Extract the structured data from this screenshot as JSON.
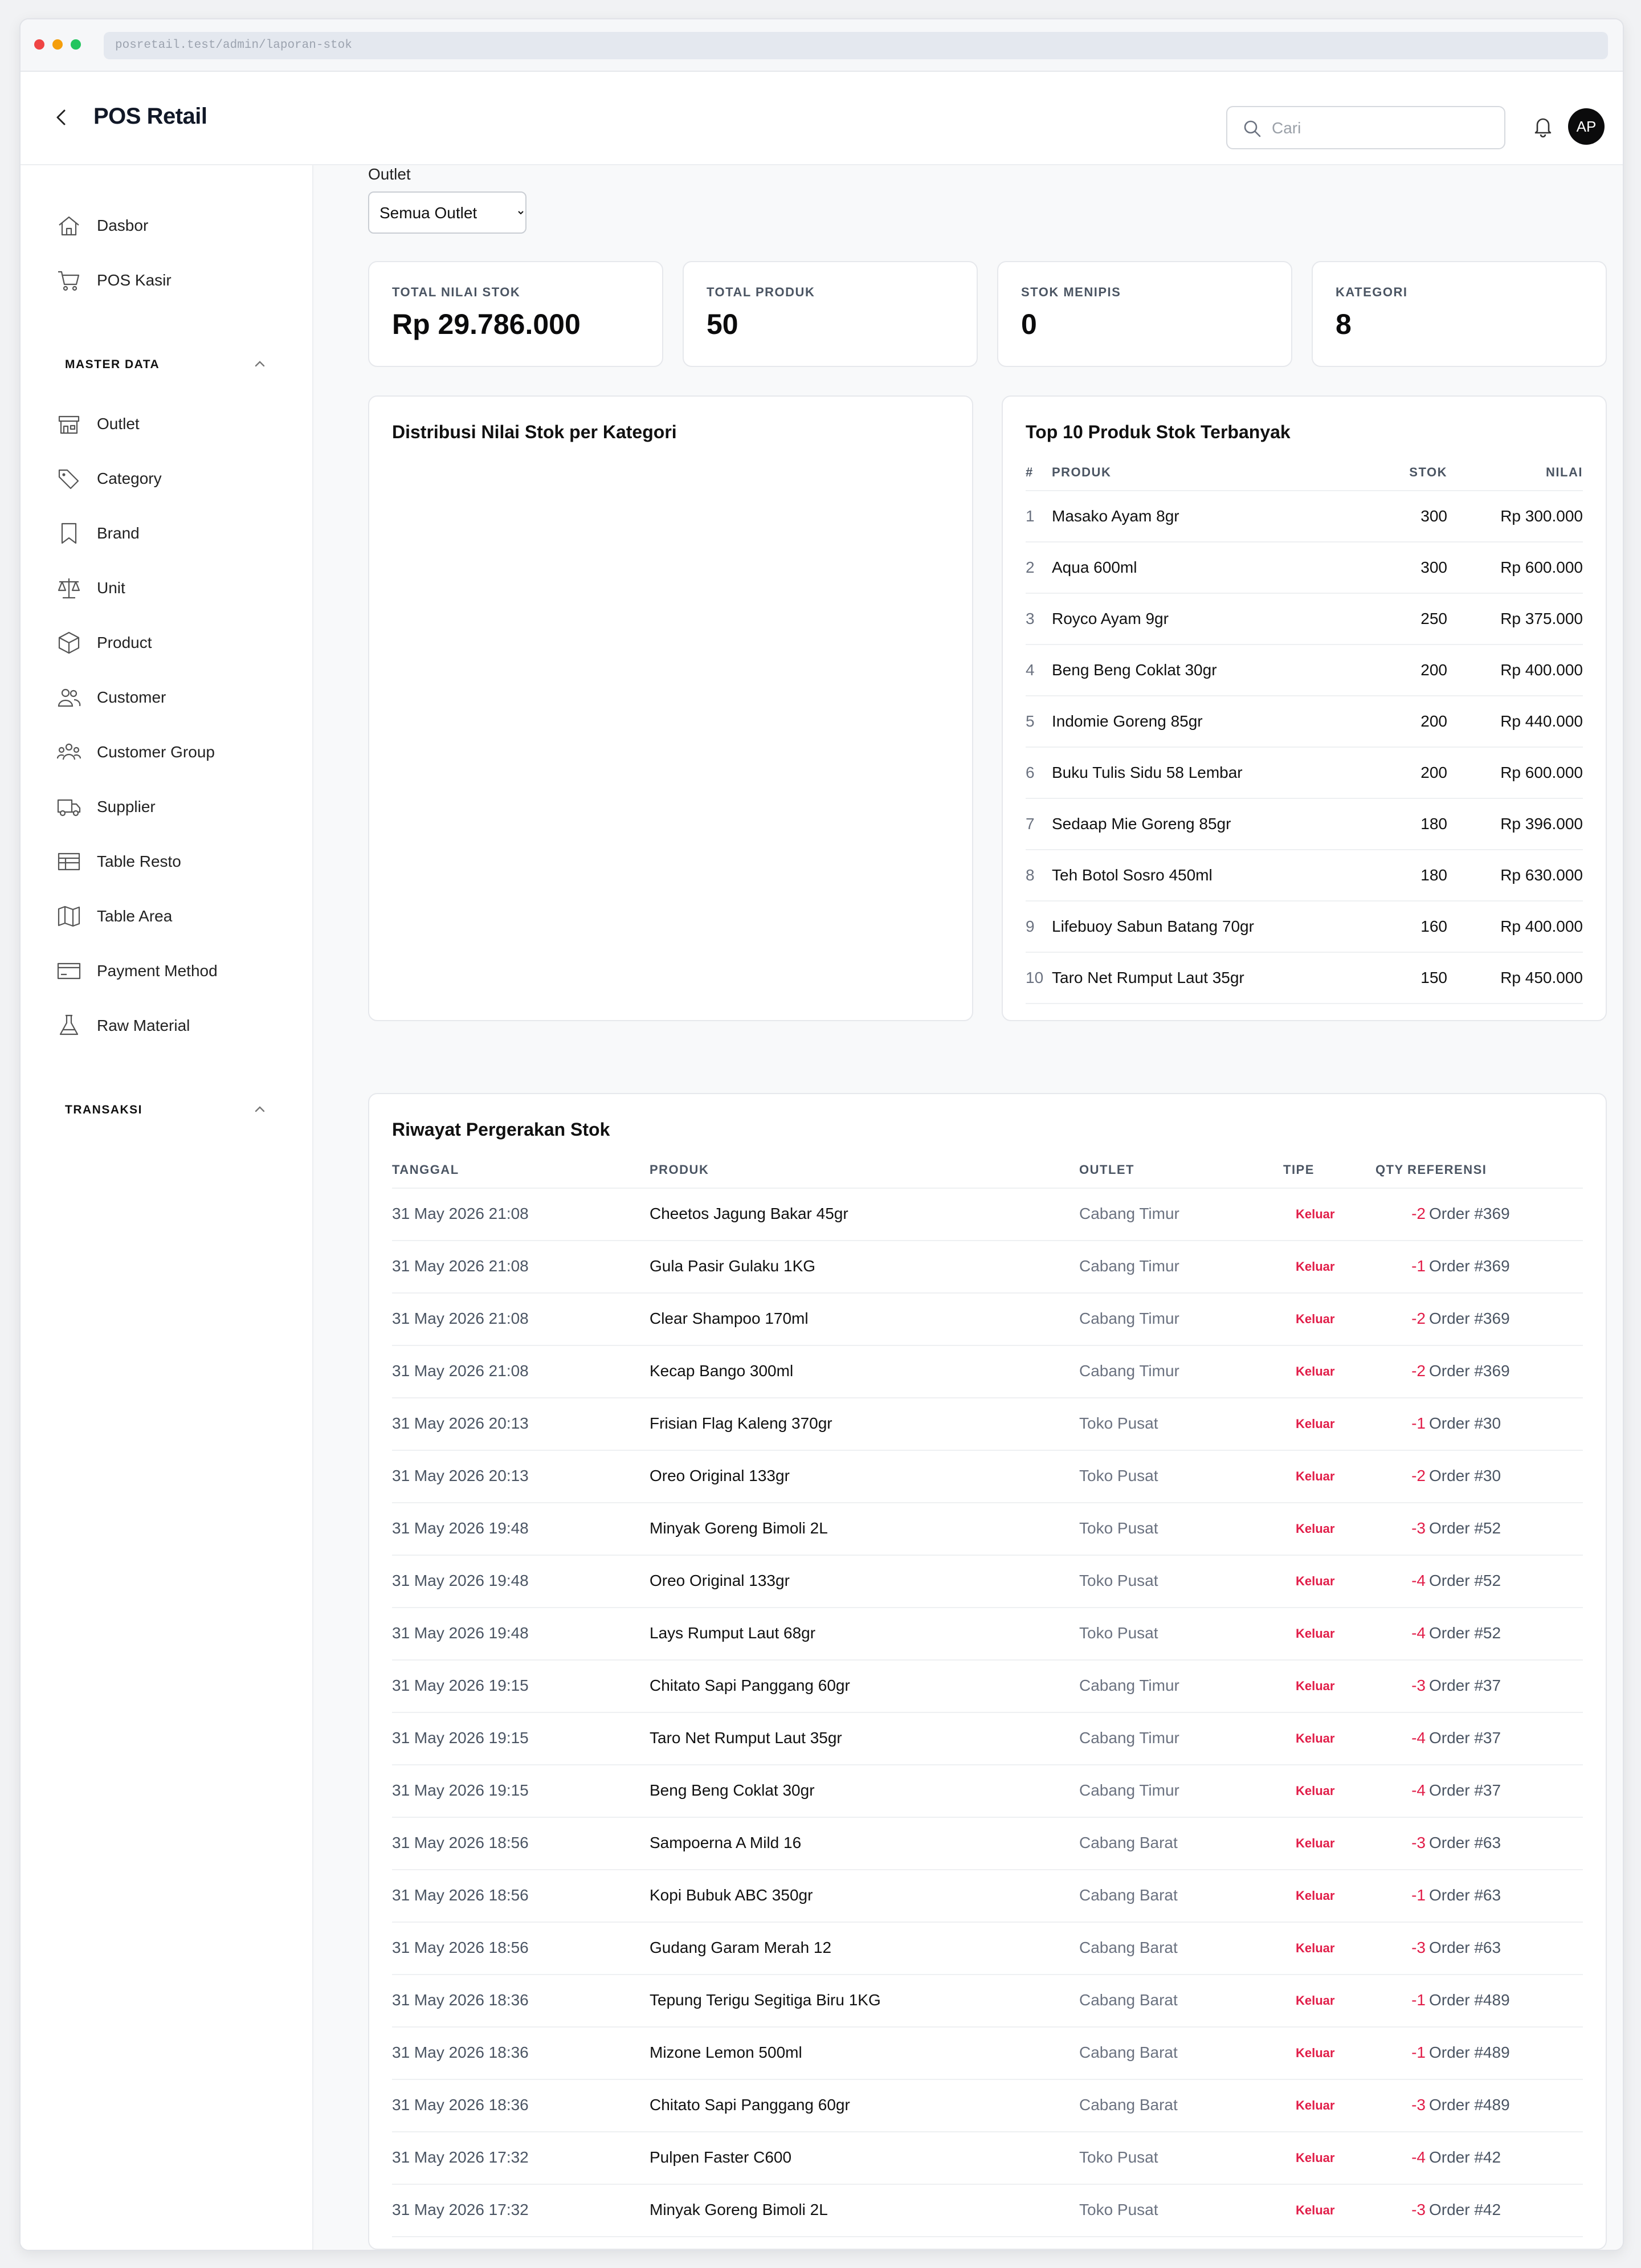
{
  "browser": {
    "url": "posretail.test/admin/laporan-stok"
  },
  "header": {
    "title": "POS Retail",
    "search_placeholder": "Cari",
    "avatar_initials": "AP"
  },
  "sidebar": {
    "top_items": [
      {
        "label": "Dasbor",
        "icon": "home-icon"
      },
      {
        "label": "POS Kasir",
        "icon": "cart-icon"
      }
    ],
    "master_data_label": "MASTER DATA",
    "master_items": [
      {
        "label": "Outlet",
        "icon": "store-icon"
      },
      {
        "label": "Category",
        "icon": "tag-icon"
      },
      {
        "label": "Brand",
        "icon": "bookmark-icon"
      },
      {
        "label": "Unit",
        "icon": "scale-icon"
      },
      {
        "label": "Product",
        "icon": "box-icon"
      },
      {
        "label": "Customer",
        "icon": "users-icon"
      },
      {
        "label": "Customer Group",
        "icon": "user-group-icon"
      },
      {
        "label": "Supplier",
        "icon": "truck-icon"
      },
      {
        "label": "Table Resto",
        "icon": "table-icon"
      },
      {
        "label": "Table Area",
        "icon": "map-icon"
      },
      {
        "label": "Payment Method",
        "icon": "credit-card-icon"
      },
      {
        "label": "Raw Material",
        "icon": "flask-icon"
      }
    ],
    "transaksi_label": "TRANSAKSI"
  },
  "filter": {
    "label": "Outlet",
    "selected": "Semua Outlet"
  },
  "stats": [
    {
      "label": "TOTAL NILAI STOK",
      "value": "Rp 29.786.000"
    },
    {
      "label": "TOTAL PRODUK",
      "value": "50"
    },
    {
      "label": "STOK MENIPIS",
      "value": "0"
    },
    {
      "label": "KATEGORI",
      "value": "8"
    }
  ],
  "distribution_card": {
    "title": "Distribusi Nilai Stok per Kategori"
  },
  "top_products": {
    "title": "Top 10 Produk Stok Terbanyak",
    "headers": {
      "num": "#",
      "product": "PRODUK",
      "stock": "STOK",
      "value": "NILAI"
    },
    "rows": [
      {
        "num": "1",
        "product": "Masako Ayam 8gr",
        "stock": "300",
        "value": "Rp 300.000"
      },
      {
        "num": "2",
        "product": "Aqua 600ml",
        "stock": "300",
        "value": "Rp 600.000"
      },
      {
        "num": "3",
        "product": "Royco Ayam 9gr",
        "stock": "250",
        "value": "Rp 375.000"
      },
      {
        "num": "4",
        "product": "Beng Beng Coklat 30gr",
        "stock": "200",
        "value": "Rp 400.000"
      },
      {
        "num": "5",
        "product": "Indomie Goreng 85gr",
        "stock": "200",
        "value": "Rp 440.000"
      },
      {
        "num": "6",
        "product": "Buku Tulis Sidu 58 Lembar",
        "stock": "200",
        "value": "Rp 600.000"
      },
      {
        "num": "7",
        "product": "Sedaap Mie Goreng 85gr",
        "stock": "180",
        "value": "Rp 396.000"
      },
      {
        "num": "8",
        "product": "Teh Botol Sosro 450ml",
        "stock": "180",
        "value": "Rp 630.000"
      },
      {
        "num": "9",
        "product": "Lifebuoy Sabun Batang 70gr",
        "stock": "160",
        "value": "Rp 400.000"
      },
      {
        "num": "10",
        "product": "Taro Net Rumput Laut 35gr",
        "stock": "150",
        "value": "Rp 450.000"
      }
    ]
  },
  "history": {
    "title": "Riwayat Pergerakan Stok",
    "headers": {
      "date": "TANGGAL",
      "product": "PRODUK",
      "outlet": "OUTLET",
      "type": "TIPE",
      "qty": "QTY",
      "ref": "REFERENSI"
    },
    "rows": [
      {
        "date": "31 May 2026 21:08",
        "product": "Cheetos Jagung Bakar 45gr",
        "outlet": "Cabang Timur",
        "type": "Keluar",
        "qty": "-2",
        "ref": "Order #369"
      },
      {
        "date": "31 May 2026 21:08",
        "product": "Gula Pasir Gulaku 1KG",
        "outlet": "Cabang Timur",
        "type": "Keluar",
        "qty": "-1",
        "ref": "Order #369"
      },
      {
        "date": "31 May 2026 21:08",
        "product": "Clear Shampoo 170ml",
        "outlet": "Cabang Timur",
        "type": "Keluar",
        "qty": "-2",
        "ref": "Order #369"
      },
      {
        "date": "31 May 2026 21:08",
        "product": "Kecap Bango 300ml",
        "outlet": "Cabang Timur",
        "type": "Keluar",
        "qty": "-2",
        "ref": "Order #369"
      },
      {
        "date": "31 May 2026 20:13",
        "product": "Frisian Flag Kaleng 370gr",
        "outlet": "Toko Pusat",
        "type": "Keluar",
        "qty": "-1",
        "ref": "Order #30"
      },
      {
        "date": "31 May 2026 20:13",
        "product": "Oreo Original 133gr",
        "outlet": "Toko Pusat",
        "type": "Keluar",
        "qty": "-2",
        "ref": "Order #30"
      },
      {
        "date": "31 May 2026 19:48",
        "product": "Minyak Goreng Bimoli 2L",
        "outlet": "Toko Pusat",
        "type": "Keluar",
        "qty": "-3",
        "ref": "Order #52"
      },
      {
        "date": "31 May 2026 19:48",
        "product": "Oreo Original 133gr",
        "outlet": "Toko Pusat",
        "type": "Keluar",
        "qty": "-4",
        "ref": "Order #52"
      },
      {
        "date": "31 May 2026 19:48",
        "product": "Lays Rumput Laut 68gr",
        "outlet": "Toko Pusat",
        "type": "Keluar",
        "qty": "-4",
        "ref": "Order #52"
      },
      {
        "date": "31 May 2026 19:15",
        "product": "Chitato Sapi Panggang 60gr",
        "outlet": "Cabang Timur",
        "type": "Keluar",
        "qty": "-3",
        "ref": "Order #37"
      },
      {
        "date": "31 May 2026 19:15",
        "product": "Taro Net Rumput Laut 35gr",
        "outlet": "Cabang Timur",
        "type": "Keluar",
        "qty": "-4",
        "ref": "Order #37"
      },
      {
        "date": "31 May 2026 19:15",
        "product": "Beng Beng Coklat 30gr",
        "outlet": "Cabang Timur",
        "type": "Keluar",
        "qty": "-4",
        "ref": "Order #37"
      },
      {
        "date": "31 May 2026 18:56",
        "product": "Sampoerna A Mild 16",
        "outlet": "Cabang Barat",
        "type": "Keluar",
        "qty": "-3",
        "ref": "Order #63"
      },
      {
        "date": "31 May 2026 18:56",
        "product": "Kopi Bubuk ABC 350gr",
        "outlet": "Cabang Barat",
        "type": "Keluar",
        "qty": "-1",
        "ref": "Order #63"
      },
      {
        "date": "31 May 2026 18:56",
        "product": "Gudang Garam Merah 12",
        "outlet": "Cabang Barat",
        "type": "Keluar",
        "qty": "-3",
        "ref": "Order #63"
      },
      {
        "date": "31 May 2026 18:36",
        "product": "Tepung Terigu Segitiga Biru 1KG",
        "outlet": "Cabang Barat",
        "type": "Keluar",
        "qty": "-1",
        "ref": "Order #489"
      },
      {
        "date": "31 May 2026 18:36",
        "product": "Mizone Lemon 500ml",
        "outlet": "Cabang Barat",
        "type": "Keluar",
        "qty": "-1",
        "ref": "Order #489"
      },
      {
        "date": "31 May 2026 18:36",
        "product": "Chitato Sapi Panggang 60gr",
        "outlet": "Cabang Barat",
        "type": "Keluar",
        "qty": "-3",
        "ref": "Order #489"
      },
      {
        "date": "31 May 2026 17:32",
        "product": "Pulpen Faster C600",
        "outlet": "Toko Pusat",
        "type": "Keluar",
        "qty": "-4",
        "ref": "Order #42"
      },
      {
        "date": "31 May 2026 17:32",
        "product": "Minyak Goreng Bimoli 2L",
        "outlet": "Toko Pusat",
        "type": "Keluar",
        "qty": "-3",
        "ref": "Order #42"
      }
    ]
  },
  "colors": {
    "accent_negative": "#e11d48",
    "avatar_bg": "#0b0b0c"
  }
}
